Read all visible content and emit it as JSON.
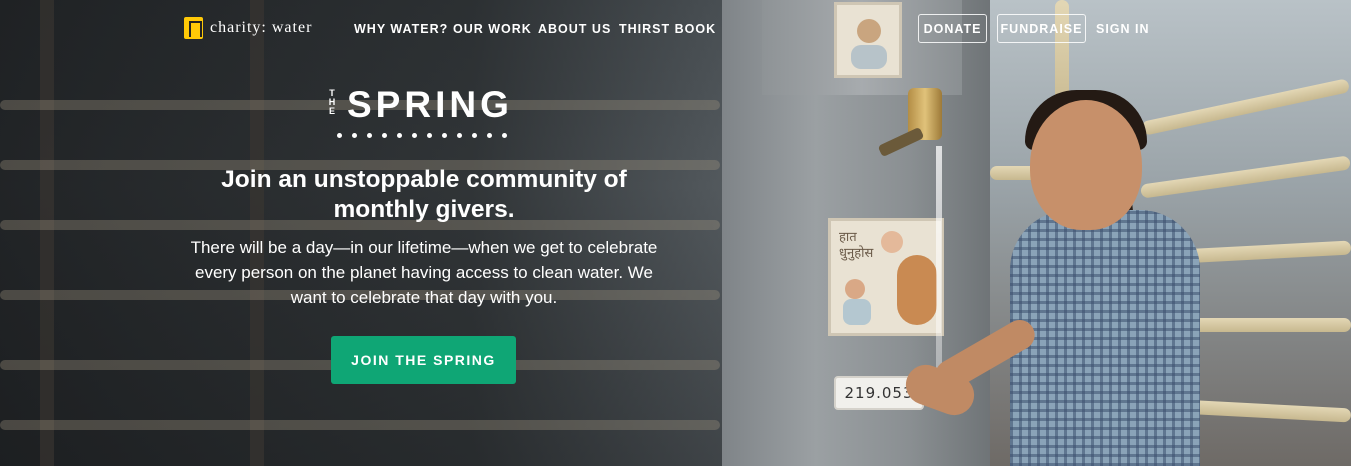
{
  "brand": {
    "logo_text": "charity: water",
    "logo_icon": "jerry-can-icon",
    "logo_color": "#ffc907"
  },
  "nav": {
    "links": [
      {
        "label": "WHY WATER?"
      },
      {
        "label": "OUR WORK"
      },
      {
        "label": "ABOUT US"
      },
      {
        "label": "THIRST BOOK"
      }
    ],
    "donate_label": "DONATE",
    "fundraise_label": "FUNDRAISE",
    "signin_label": "SIGN IN"
  },
  "hero": {
    "wordmark_the": "THE",
    "wordmark_main": "SPRING",
    "headline": "Join an unstoppable community of monthly givers.",
    "body": "There will be a day—in our lifetime—when we get to celebrate every person on the planet having access to clean water. We want to celebrate that day with you.",
    "cta_label": "JOIN THE SPRING",
    "cta_color": "#0fa675",
    "plate_number": "219.053"
  }
}
